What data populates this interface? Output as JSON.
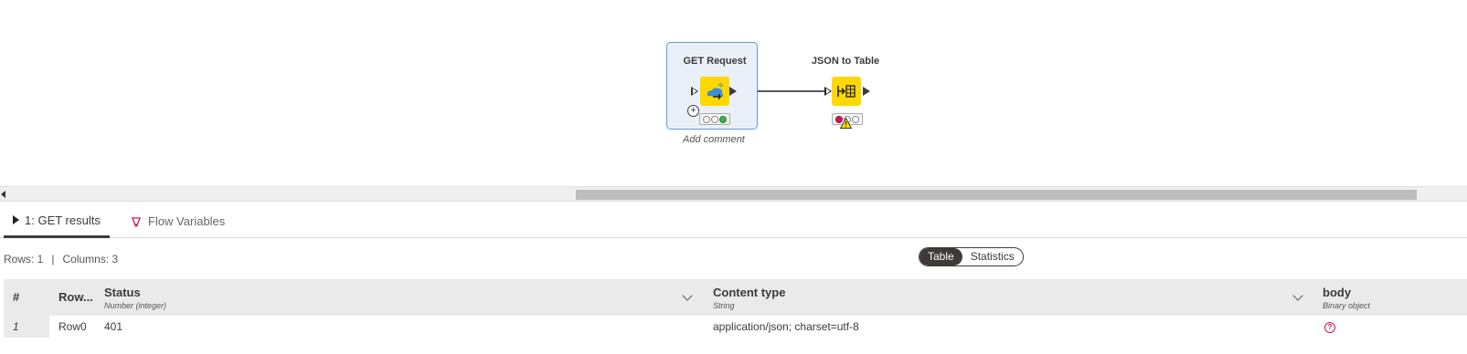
{
  "canvas": {
    "nodes": [
      {
        "title": "GET Request",
        "comment": "Add comment",
        "status": [
          "off",
          "off",
          "green"
        ],
        "icon": "rest-get-icon",
        "selected": true
      },
      {
        "title": "JSON to Table",
        "status": [
          "red",
          "off",
          "off"
        ],
        "icon": "json-to-table-icon",
        "warning": true
      }
    ]
  },
  "tabs": [
    {
      "label": "1: GET results",
      "icon": "play-triangle-icon",
      "active": true
    },
    {
      "label": "Flow Variables",
      "icon": "flow-variable-icon",
      "active": false
    }
  ],
  "info": {
    "rows_label": "Rows: 1",
    "sep": "|",
    "columns_label": "Columns: 3"
  },
  "view_toggle": {
    "options": [
      "Table",
      "Statistics"
    ],
    "selected": "Table"
  },
  "table": {
    "index_header": "#",
    "rowid_header": "Row...",
    "columns": [
      {
        "name": "Status",
        "type": "Number (integer)"
      },
      {
        "name": "Content type",
        "type": "String"
      },
      {
        "name": "body",
        "type": "Binary object"
      }
    ],
    "rows": [
      {
        "index": "1",
        "rowid": "Row0",
        "status": "401",
        "content_type": "application/json; charset=utf-8",
        "body_icon": "missing-value-icon",
        "body_glyph": "?"
      }
    ]
  },
  "colors": {
    "node_yellow": "#ffd800",
    "selection_blue": "#5a9ed6",
    "warning_yellow": "#ffd800",
    "error_red": "#d4145a",
    "success_green": "#3cb44b"
  }
}
